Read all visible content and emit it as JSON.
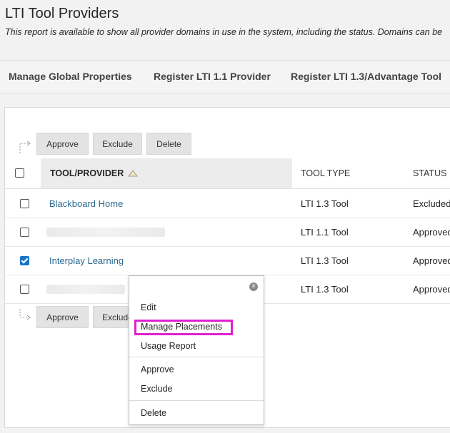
{
  "page": {
    "title": "LTI Tool Providers",
    "description": "This report is available to show all provider domains in use in the system, including the status. Domains can be"
  },
  "nav": {
    "items": [
      "Manage Global Properties",
      "Register LTI 1.1 Provider",
      "Register LTI 1.3/Advantage Tool"
    ]
  },
  "actions": {
    "approve": "Approve",
    "exclude": "Exclude",
    "delete": "Delete"
  },
  "table": {
    "columns": {
      "tool": "TOOL/PROVIDER",
      "type": "TOOL TYPE",
      "status": "STATUS"
    },
    "rows": [
      {
        "name": "Blackboard Home",
        "type": "LTI 1.3 Tool",
        "status": "Excluded",
        "checked": false
      },
      {
        "name": "",
        "type": "LTI 1.1 Tool",
        "status": "Approved",
        "checked": false
      },
      {
        "name": "Interplay Learning",
        "type": "LTI 1.3 Tool",
        "status": "Approved",
        "checked": true
      },
      {
        "name": "",
        "type": "LTI 1.3 Tool",
        "status": "Approved",
        "checked": false
      }
    ]
  },
  "context_menu": {
    "items": [
      "Edit",
      "Manage Placements",
      "Usage Report",
      "Approve",
      "Exclude",
      "Delete"
    ],
    "highlighted": "Manage Placements",
    "highlight_color": "#e020d0"
  },
  "colors": {
    "link": "#2b6a8f",
    "checkbox_checked": "#1a73c8"
  }
}
